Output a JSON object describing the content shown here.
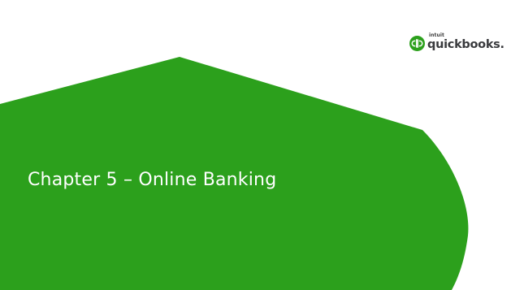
{
  "slide": {
    "title": "Chapter 5 – Online Banking"
  },
  "logo": {
    "intuit_text": "intuit",
    "brand_text": "quickbooks."
  },
  "colors": {
    "shape_green": "#2ca01c",
    "background": "#ffffff",
    "title_text": "#ffffff",
    "logo_text": "#393a3d"
  },
  "icons": {
    "logo_mark": "quickbooks-logo-icon"
  }
}
